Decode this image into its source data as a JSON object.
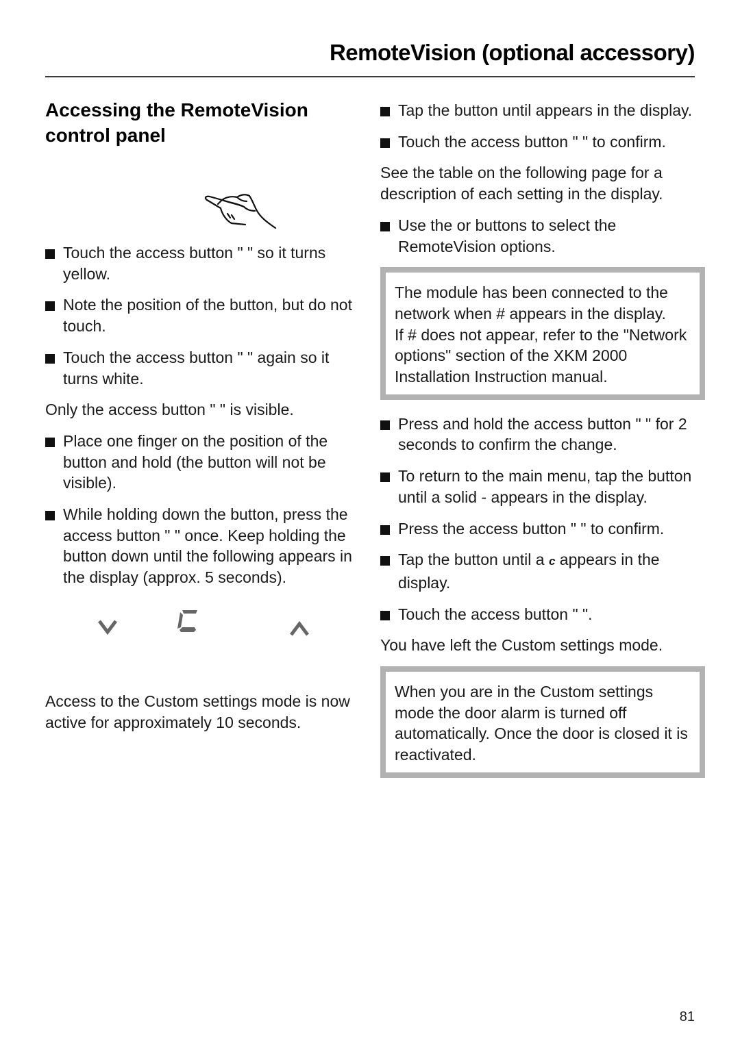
{
  "header": {
    "title": "RemoteVision (optional accessory)"
  },
  "left_column": {
    "section_title_line1": "Accessing the RemoteVision",
    "section_title_line2": "control panel",
    "illustration_icon": "hand-touch-icon",
    "steps": [
      {
        "type": "bullet",
        "text": "Touch the access button \"  \" so it turns yellow."
      },
      {
        "type": "bullet",
        "text": "Note the position of the     button, but do not touch."
      },
      {
        "type": "bullet",
        "text": "Touch the access button \"  \" again so it turns white."
      },
      {
        "type": "para",
        "text": "Only the access button \"  \" is visible."
      },
      {
        "type": "bullet",
        "text": "Place one finger on the position of the     button and hold (the     button will not be visible)."
      },
      {
        "type": "bullet",
        "text": "While holding down the     button, press the access button \"  \" once. Keep holding the     button down until the following appears in the display (approx. 5 seconds)."
      }
    ],
    "display": {
      "left_icon": "chevron-down-icon",
      "center_icon": "segment-c-icon",
      "right_icon": "chevron-up-icon",
      "color": "#666666"
    },
    "closing_para": "Access to the Custom settings mode is now active for approximately 10 seconds."
  },
  "right_column": {
    "steps_a": [
      {
        "type": "bullet",
        "text": "Tap the     button until     appears in the display."
      },
      {
        "type": "bullet",
        "text": "Touch the access button \"  \" to confirm."
      },
      {
        "type": "para",
        "text": "See the table on the following page for a description of each setting in the display."
      },
      {
        "type": "bullet",
        "text": "Use the     or     buttons to select the RemoteVision options."
      }
    ],
    "note1": {
      "line1": "The module has been connected to the network when    # appears in the display.",
      "line2": "If    # does not appear, refer to the \"Network options\" section of the XKM 2000 Installation Instruction manual."
    },
    "steps_b": [
      {
        "type": "bullet",
        "text": "Press and hold the access button \"  \" for 2 seconds to confirm the change."
      },
      {
        "type": "bullet",
        "text": "To return to the main menu, tap the     button until a solid    -  appears in the display."
      },
      {
        "type": "bullet",
        "text": "Press the access button \"  \" to confirm."
      }
    ],
    "tap_c": {
      "before": "Tap the     button until a ",
      "c_glyph": "c",
      "after": " appears in the display."
    },
    "steps_c": [
      {
        "type": "bullet",
        "text": "Touch the access button \"  \"."
      },
      {
        "type": "para",
        "text": "You have left the Custom settings mode."
      }
    ],
    "note2": {
      "text": "When you are in the Custom settings mode the door alarm is turned off automatically. Once the door is closed it is reactivated."
    }
  },
  "footer": {
    "page_number": "81"
  },
  "colors": {
    "note_border": "#b2b2b2",
    "display_glyph": "#666666",
    "text": "#1a1a1a"
  }
}
